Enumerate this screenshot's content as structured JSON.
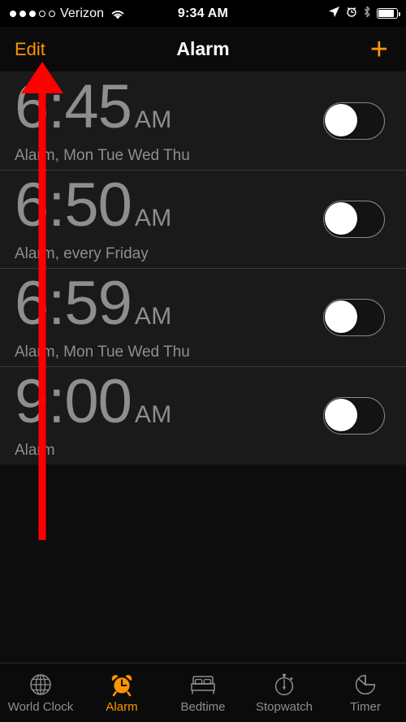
{
  "status_bar": {
    "signal_dots_filled": 3,
    "signal_dots_total": 5,
    "carrier": "Verizon",
    "wifi_icon": "wifi-icon",
    "time": "9:34 AM",
    "location_icon": "location-arrow-icon",
    "alarm_icon": "alarm-clock-icon",
    "bluetooth_icon": "bluetooth-icon",
    "battery_icon": "battery-icon"
  },
  "nav": {
    "edit_label": "Edit",
    "title": "Alarm",
    "add_label": "+"
  },
  "alarms": [
    {
      "time": "6:45",
      "period": "AM",
      "label": "Alarm, Mon Tue Wed Thu",
      "enabled": false
    },
    {
      "time": "6:50",
      "period": "AM",
      "label": "Alarm, every Friday",
      "enabled": false
    },
    {
      "time": "6:59",
      "period": "AM",
      "label": "Alarm, Mon Tue Wed Thu",
      "enabled": false
    },
    {
      "time": "9:00",
      "period": "AM",
      "label": "Alarm",
      "enabled": false
    }
  ],
  "tabs": [
    {
      "label": "World Clock",
      "icon": "globe-icon",
      "active": false
    },
    {
      "label": "Alarm",
      "icon": "alarm-clock-icon",
      "active": true
    },
    {
      "label": "Bedtime",
      "icon": "bed-icon",
      "active": false
    },
    {
      "label": "Stopwatch",
      "icon": "stopwatch-icon",
      "active": false
    },
    {
      "label": "Timer",
      "icon": "timer-icon",
      "active": false
    }
  ],
  "annotation": {
    "type": "arrow",
    "color": "#ff0000",
    "points_to": "Edit"
  },
  "colors": {
    "accent": "#ff9500",
    "background": "#0d0d0d",
    "cell_background": "#1a1a1a",
    "dim_text": "#8e8e8e",
    "annotation": "#ff0000"
  }
}
